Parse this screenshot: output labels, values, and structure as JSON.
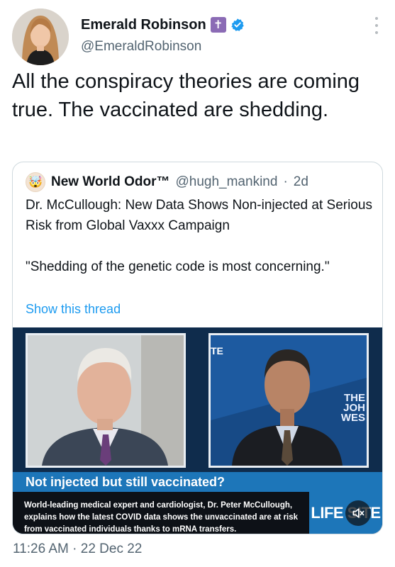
{
  "author": {
    "name": "Emerald Robinson",
    "handle": "@EmeraldRobinson",
    "badge_icon": "latin-cross-icon",
    "verified_icon": "verified-badge-icon"
  },
  "tweet": {
    "text": "All the conspiracy theories are coming true. The vaccinated are shedding.",
    "timestamp": "11:26 AM · 22 Dec 22"
  },
  "quoted": {
    "name": "New World Odor™",
    "handle": "@hugh_mankind",
    "separator": "·",
    "age": "2d",
    "paragraph1": "Dr. McCullough: New Data Shows Non-injected at Serious Risk from Global Vaxxx Campaign",
    "paragraph2": "\"Shedding of the genetic code is most concerning.\"",
    "show_thread": "Show this thread"
  },
  "video": {
    "banner": "Not injected but still vaccinated?",
    "caption": "World-leading medical expert and cardiologist, Dr. Peter McCullough, explains how the latest COVID data shows the unvaccinated are at risk from vaccinated individuals thanks to mRNA transfers.",
    "brand": "LIFE SITE",
    "corner_mark": "TE",
    "right_panel_text": "THE JOH WES"
  },
  "colors": {
    "accent": "#1d9bf0",
    "muted_text": "#536471",
    "banner_blue": "#1d76b9",
    "caption_bg": "#0d1117"
  }
}
